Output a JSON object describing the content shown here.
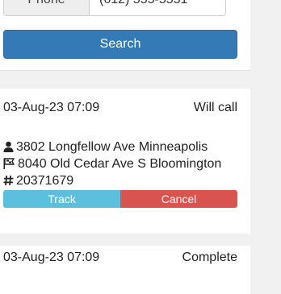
{
  "search": {
    "phone_label": "Phone",
    "phone_value": "(612) 555-5551",
    "search_label": "Search"
  },
  "orders": [
    {
      "datetime": "03-Aug-23 07:09",
      "status": "Will call",
      "pickup_icon": "user-icon",
      "pickup_address": "3802 Longfellow Ave Minneapolis",
      "dropoff_icon": "flag-icon",
      "dropoff_address": "8040 Old Cedar Ave S Bloomington",
      "number_icon": "hashtag-icon",
      "order_number": "20371679",
      "track_label": "Track",
      "cancel_label": "Cancel"
    },
    {
      "datetime": "03-Aug-23 07:09",
      "status": "Complete"
    }
  ],
  "colors": {
    "primary": "#337ab7",
    "info": "#5bc0de",
    "danger": "#d9534f"
  }
}
